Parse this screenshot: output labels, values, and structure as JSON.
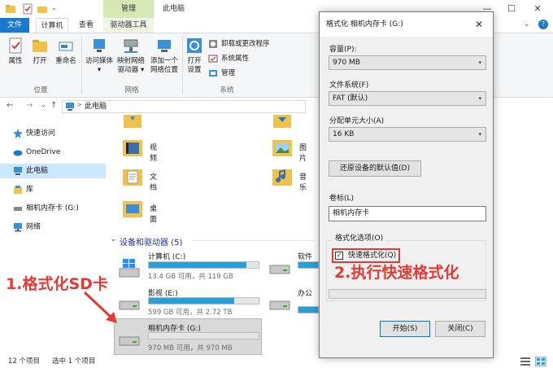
{
  "window": {
    "title": "此电脑",
    "manage_tab": "管理",
    "minimize": "—",
    "maximize": "☐",
    "close": "✕",
    "chevron": "⌄",
    "help": "?"
  },
  "ribbon_tabs": {
    "file": "文件",
    "computer": "计算机",
    "view": "查看",
    "drive_tools": "驱动器工具"
  },
  "ribbon": {
    "properties": "属性",
    "open": "打开",
    "rename": "重命名",
    "group_location": "位置",
    "access_media_1": "访问媒体",
    "access_media_2": "▾",
    "map_drive_1": "映射网络",
    "map_drive_2": "驱动器 ▾",
    "add_location_1": "添加一个",
    "add_location_2": "网络位置",
    "group_network": "网络",
    "open_settings_1": "打开",
    "open_settings_2": "设置",
    "uninstall": "卸载或更改程序",
    "system_props": "系统属性",
    "manage": "管理",
    "group_system": "系统"
  },
  "address": {
    "back": "←",
    "forward": "→",
    "recent": "⌄",
    "up": "↑",
    "path": "此电脑",
    "separator": ">"
  },
  "nav": {
    "items": [
      {
        "label": "快速访问",
        "icon": "star-icon"
      },
      {
        "label": "OneDrive",
        "icon": "cloud-icon"
      },
      {
        "label": "此电脑",
        "icon": "computer-icon"
      },
      {
        "label": "库",
        "icon": "library-icon"
      },
      {
        "label": "相机内存卡 (G:)",
        "icon": "drive-icon"
      },
      {
        "label": "网络",
        "icon": "network-icon"
      }
    ]
  },
  "folders": {
    "videos": "视频",
    "pictures": "图片",
    "documents": "文档",
    "music": "音乐",
    "desktop": "桌面"
  },
  "devices": {
    "header": "设备和驱动器 (5)",
    "drives": [
      {
        "name": "计算机 (C:)",
        "info": "13.4 GB 可用，共 119 GB",
        "used_fraction": 0.89
      },
      {
        "name": "影视 (E:)",
        "info": "599 GB 可用，共 2.72 TB",
        "used_fraction": 0.78
      },
      {
        "name": "相机内存卡 (G:)",
        "info": "970 MB 可用，共 970 MB",
        "used_fraction": 0.0
      }
    ],
    "drive_d_name": "软件",
    "drive_f_name": "办公"
  },
  "status": {
    "count": "12 个项目",
    "selected": "选中 1 个项目"
  },
  "dialog": {
    "title": "格式化 相机内存卡 (G:)",
    "close": "✕",
    "capacity_label": "容量(P):",
    "capacity_value": "970 MB",
    "fs_label": "文件系统(F)",
    "fs_value": "FAT (默认)",
    "unit_label": "分配单元大小(A)",
    "unit_value": "16 KB",
    "restore_button": "还原设备的默认值(D)",
    "volume_label": "卷标(L)",
    "volume_value": "相机内存卡",
    "options_legend": "格式化选项(O)",
    "quick_format": "快速格式化(Q)",
    "quick_checked": "✓",
    "start_button": "开始(S)",
    "close_button": "关闭(C)",
    "dropdown_arrow": "▾"
  },
  "annotations": {
    "step1": "1.格式化SD卡",
    "step2": "2.执行快速格式化"
  },
  "colors": {
    "accent": "#1979ca",
    "drive_fill": "#26a0da",
    "annotation": "#e53935",
    "manage_tab": "#d5e8b6"
  }
}
